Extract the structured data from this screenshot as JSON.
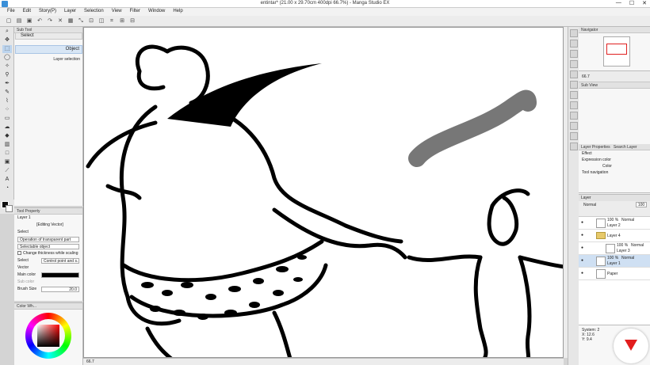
{
  "window": {
    "title": "entintar* (21.00 x 29.70cm 400dpi 66.7%) - Manga Studio EX",
    "controls": [
      "—",
      "☐",
      "✕"
    ]
  },
  "menu": [
    "File",
    "Edit",
    "Story(P)",
    "Layer",
    "Selection",
    "View",
    "Filter",
    "Window",
    "Help"
  ],
  "subtool_panel": {
    "header": "Sub Tool",
    "tab_label": "Select",
    "object_label": "Object",
    "layer_selection_label": "Layer selection"
  },
  "tool_property": {
    "header": "Tool Property",
    "layer_name": "Layer 1",
    "editing": "[Editing Vector]",
    "select_label": "Select",
    "operation": "Operation of transparent part",
    "selectable": "Selectable object",
    "change_thickness": "Change thickness while scaling",
    "select_row_label": "Select",
    "select_value": "Control point and s...",
    "vector_label": "Vector",
    "main_color_label": "Main color",
    "sub_color_label": "Sub color",
    "brush_size_label": "Brush Size",
    "brush_size_value": "20.0"
  },
  "color_wheel": {
    "header": "Color Wh..."
  },
  "canvas": {
    "zoom_status": "66.7"
  },
  "navigator": {
    "header": "Navigator",
    "zoom": "66.7"
  },
  "subview": {
    "header": "Sub View"
  },
  "layer_property": {
    "header": "Layer Properties",
    "tab2": "Search Layer",
    "effect_label": "Effect",
    "expression_color_label": "Expression color",
    "expression_color_value": "Color",
    "tool_navigation_label": "Tool navigation"
  },
  "layer_panel": {
    "tabs": "Layer",
    "blend_mode": "Normal",
    "opacity": "100",
    "layers": [
      {
        "opacity": "100 %",
        "blend": "Normal",
        "name": "Layer 2",
        "type": "raster",
        "indent": false,
        "selected": false
      },
      {
        "opacity": "",
        "blend": "",
        "name": "Layer 4",
        "type": "folder",
        "indent": false,
        "selected": false
      },
      {
        "opacity": "100 %",
        "blend": "Normal",
        "name": "Layer 3",
        "type": "raster",
        "indent": true,
        "selected": false
      },
      {
        "opacity": "100 %",
        "blend": "Normal",
        "name": "Layer 1",
        "type": "raster",
        "indent": false,
        "selected": true
      },
      {
        "opacity": "",
        "blend": "",
        "name": "Paper",
        "type": "paper",
        "indent": false,
        "selected": false
      }
    ]
  },
  "info": {
    "line1": "System: 2",
    "line2": "X: 12.6",
    "line3": "Y: 9.4"
  },
  "colors": {
    "accent": "#e21d1d",
    "selection": "#cfe0f3",
    "ink": "#000000"
  }
}
